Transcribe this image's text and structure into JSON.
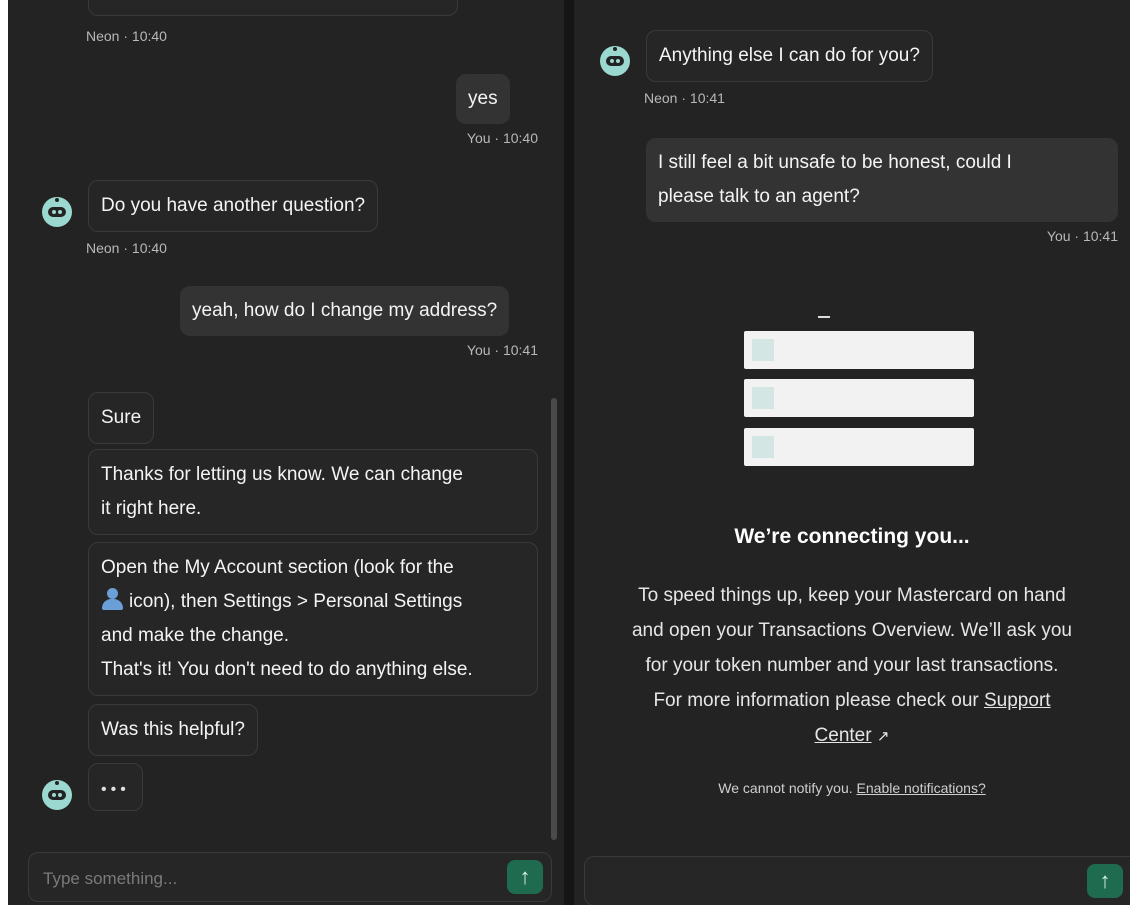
{
  "left": {
    "meta_top": "Neon · 10:40",
    "msg_yes": "yes",
    "meta_yes": "You · 10:40",
    "msg_another": "Do you have another question?",
    "meta_another": "Neon · 10:40",
    "msg_address": "yeah, how do I change my address?",
    "meta_address": "You · 10:41",
    "msg_sure": "Sure",
    "msg_thanks_1": "Thanks for letting us know. We can change",
    "msg_thanks_2": "it right here.",
    "msg_open_1": "Open the My Account section (look for the",
    "msg_open_2": "icon), then Settings > Personal Settings",
    "msg_open_3": "and make the change.",
    "msg_open_4": "That's it! You don't need to do anything else.",
    "msg_helpful": "Was this helpful?",
    "typing_dots": "•••",
    "input_placeholder": "Type something..."
  },
  "right": {
    "msg_anything": "Anything else I can do for you?",
    "meta_anything": "Neon · 10:41",
    "msg_agent_1": "I still feel a bit unsafe to be honest, could I",
    "msg_agent_2": "please talk to an agent?",
    "meta_agent": "You · 10:41",
    "connecting_title": "We’re connecting you...",
    "connecting_line_1": "To speed things up, keep your Mastercard on hand",
    "connecting_line_2": "and open your Transactions Overview. We’ll ask you",
    "connecting_line_3": "for your token number and your last transactions.",
    "connecting_line_4_prefix": "For more information please check our",
    "support_link_a": "Support",
    "support_link_b": "Center",
    "external_arrow": "↗",
    "notify_text": "We cannot notify you.",
    "notify_link": "Enable notifications?"
  },
  "send_icon": "↑",
  "icons": [
    "bot-avatar-icon",
    "user-icon",
    "send-arrow-icon",
    "external-link-icon"
  ],
  "colors": {
    "background": "#232323",
    "bubble_bot": "#262626",
    "bubble_user": "#333333",
    "avatar": "#9bd8cf",
    "send": "#1f6b4f"
  }
}
